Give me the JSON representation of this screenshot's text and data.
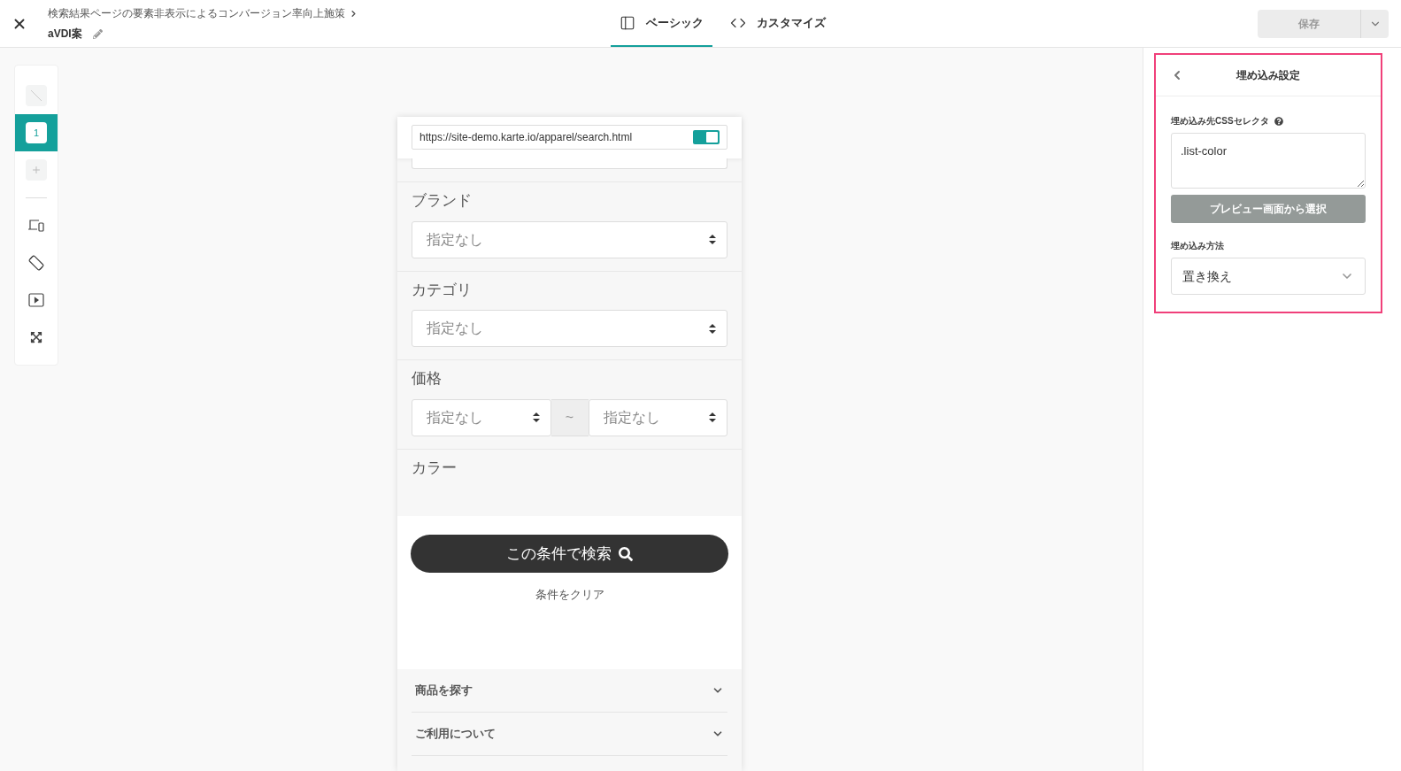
{
  "header": {
    "breadcrumb": "検索結果ページの要素非表示によるコンバージョン率向上施策",
    "title": "aVDI案",
    "tabs": [
      {
        "label": "ベーシック",
        "kind": "layout",
        "selected": true
      },
      {
        "label": "カスタマイズ",
        "kind": "code",
        "selected": false
      }
    ],
    "save_button": {
      "label": "保存",
      "disabled": true
    }
  },
  "toolbar": {
    "variants": [
      {
        "kind": "none",
        "selected": false
      },
      {
        "kind": "number",
        "label": "1",
        "selected": true
      },
      {
        "kind": "add",
        "selected": false
      }
    ]
  },
  "preview": {
    "url": "https://site-demo.karte.io/apparel/search.html",
    "url_toggle_on": true,
    "filters": [
      {
        "label": "ブランド",
        "selects": [
          "指定なし"
        ]
      },
      {
        "label": "カテゴリ",
        "selects": [
          "指定なし"
        ]
      },
      {
        "label": "価格",
        "selects": [
          "指定なし",
          "指定なし"
        ],
        "separator": "~"
      },
      {
        "label": "カラー"
      }
    ],
    "search_button": "この条件で検索",
    "clear_link": "条件をクリア",
    "footer_items": [
      {
        "label": "商品を探す",
        "expanded": false
      },
      {
        "label": "ご利用について",
        "expanded": false
      }
    ]
  },
  "panel": {
    "title": "埋め込み設定",
    "selector_label": "埋め込み先CSSセレクタ",
    "selector_value": ".list-color",
    "pick_button": "プレビュー画面から選択",
    "method_label": "埋め込み方法",
    "method_value": "置き換え"
  }
}
